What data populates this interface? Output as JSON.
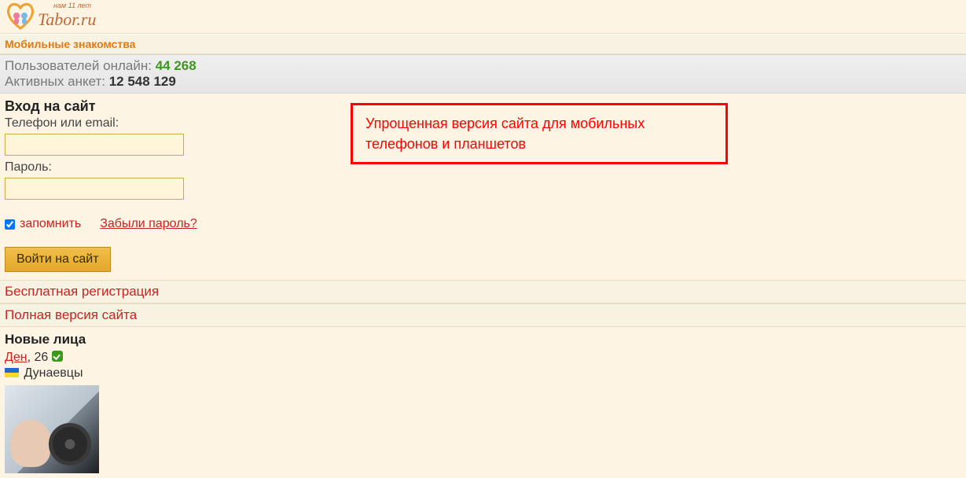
{
  "header": {
    "logo_tagline": "нам 11 лет",
    "logo_text": "Tabor.ru"
  },
  "subtitle": "Мобильные знакомства",
  "stats": {
    "online_label": "Пользователей онлайн: ",
    "online_count": "44 268",
    "profiles_label": "Активных анкет: ",
    "profiles_count": "12 548 129"
  },
  "login": {
    "title": "Вход на сайт",
    "email_label": "Телефон или email:",
    "password_label": "Пароль:",
    "remember_label": "запомнить",
    "forgot_label": "Забыли пароль?",
    "submit_label": "Войти на сайт"
  },
  "callout": "Упрощенная версия сайта для мобильных телефонов и планшетов",
  "links": {
    "register": "Бесплатная регистрация",
    "full_version": "Полная версия сайта"
  },
  "new_faces": {
    "title": "Новые лица",
    "profile": {
      "name": "Ден",
      "age_separator": ", ",
      "age": "26",
      "location": "Дунаевцы"
    }
  }
}
